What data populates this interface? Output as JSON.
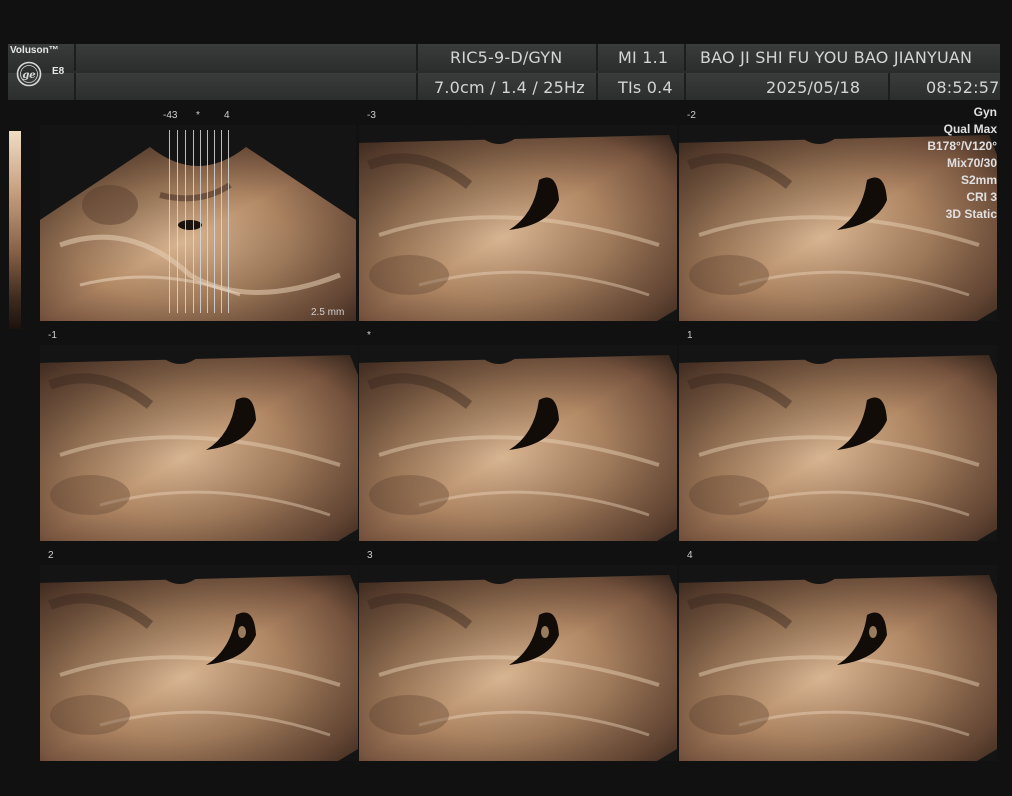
{
  "brand": {
    "name": "Voluson™",
    "probe": "E8"
  },
  "header": {
    "probe_mode": "RIC5-9-D/GYN",
    "mi": "MI  1.1",
    "institution": "BAO JI SHI FU YOU BAO JIANYUAN",
    "depth_info": "7.0cm / 1.4 / 25Hz",
    "tis": "TIs  0.4",
    "date": "2025/05/18",
    "time": "08:52:57"
  },
  "params": [
    "Gyn",
    "Qual Max",
    "B178°/V120°",
    "Mix70/30",
    "S2mm",
    "CRI 3",
    "3D Static"
  ],
  "reference": {
    "left_label": "-43",
    "mid_label": "*",
    "right_label": "4",
    "spacing": "2.5 mm"
  },
  "slices": [
    {
      "label": "-3"
    },
    {
      "label": "-2"
    },
    {
      "label": "-1"
    },
    {
      "label": "*"
    },
    {
      "label": "1"
    },
    {
      "label": "2"
    },
    {
      "label": "3"
    },
    {
      "label": "4"
    }
  ],
  "colors": {
    "tissue_light": "#d8b592",
    "tissue_mid": "#a9805e",
    "tissue_dark": "#5e4030",
    "background": "#111111"
  }
}
